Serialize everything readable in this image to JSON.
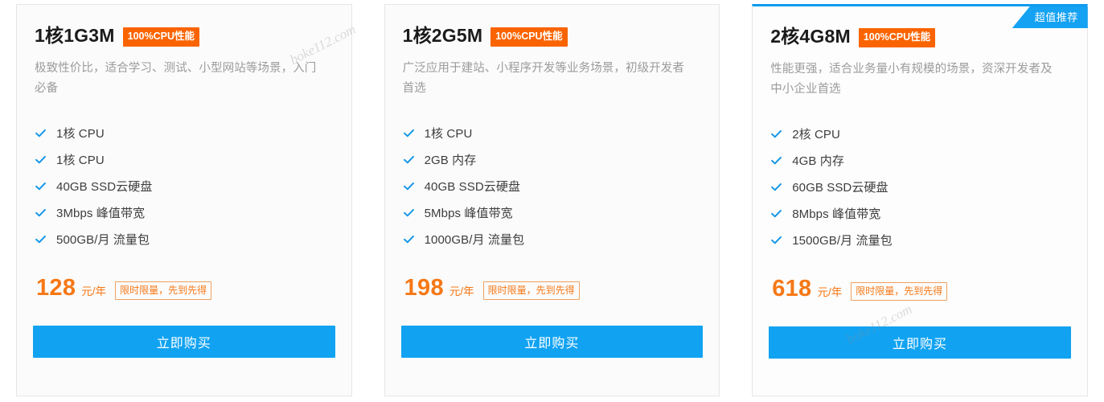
{
  "theme": {
    "accent_blue": "#11a3f2",
    "ribbon_blue": "#15a2f2",
    "badge_orange": "#fa6400",
    "price_orange": "#f67816",
    "card_border": "#e6e6e6",
    "card_bg": "#fbfbfb",
    "feature_text": "#3d3d3d",
    "desc_text": "#9b9b9b"
  },
  "cpu_badge_label": "100%CPU性能",
  "price_unit": "元/年",
  "promo_tag": "限时限量，先到先得",
  "buy_label": "立即购买",
  "ribbon_label": "超值推荐",
  "watermarks": [
    {
      "text": "boke112.com"
    },
    {
      "text": "boke112.com"
    }
  ],
  "cards": [
    {
      "title": "1核1G3M",
      "cpu_badge": "100%CPU性能",
      "description": "极致性价比，适合学习、测试、小型网站等场景，入门必备",
      "features": [
        "1核 CPU",
        "1核 CPU",
        "40GB SSD云硬盘",
        "3Mbps 峰值带宽",
        "500GB/月 流量包"
      ],
      "price": "128",
      "price_unit": "元/年",
      "promo_tag": "限时限量，先到先得",
      "buy_label": "立即购买",
      "featured": false,
      "ribbon_label": ""
    },
    {
      "title": "1核2G5M",
      "cpu_badge": "100%CPU性能",
      "description": "广泛应用于建站、小程序开发等业务场景，初级开发者首选",
      "features": [
        "1核 CPU",
        "2GB 内存",
        "40GB SSD云硬盘",
        "5Mbps 峰值带宽",
        "1000GB/月 流量包"
      ],
      "price": "198",
      "price_unit": "元/年",
      "promo_tag": "限时限量，先到先得",
      "buy_label": "立即购买",
      "featured": false,
      "ribbon_label": ""
    },
    {
      "title": "2核4G8M",
      "cpu_badge": "100%CPU性能",
      "description": "性能更强，适合业务量小有规模的场景，资深开发者及中小企业首选",
      "features": [
        "2核 CPU",
        "4GB 内存",
        "60GB SSD云硬盘",
        "8Mbps 峰值带宽",
        "1500GB/月 流量包"
      ],
      "price": "618",
      "price_unit": "元/年",
      "promo_tag": "限时限量，先到先得",
      "buy_label": "立即购买",
      "featured": true,
      "ribbon_label": "超值推荐"
    }
  ]
}
